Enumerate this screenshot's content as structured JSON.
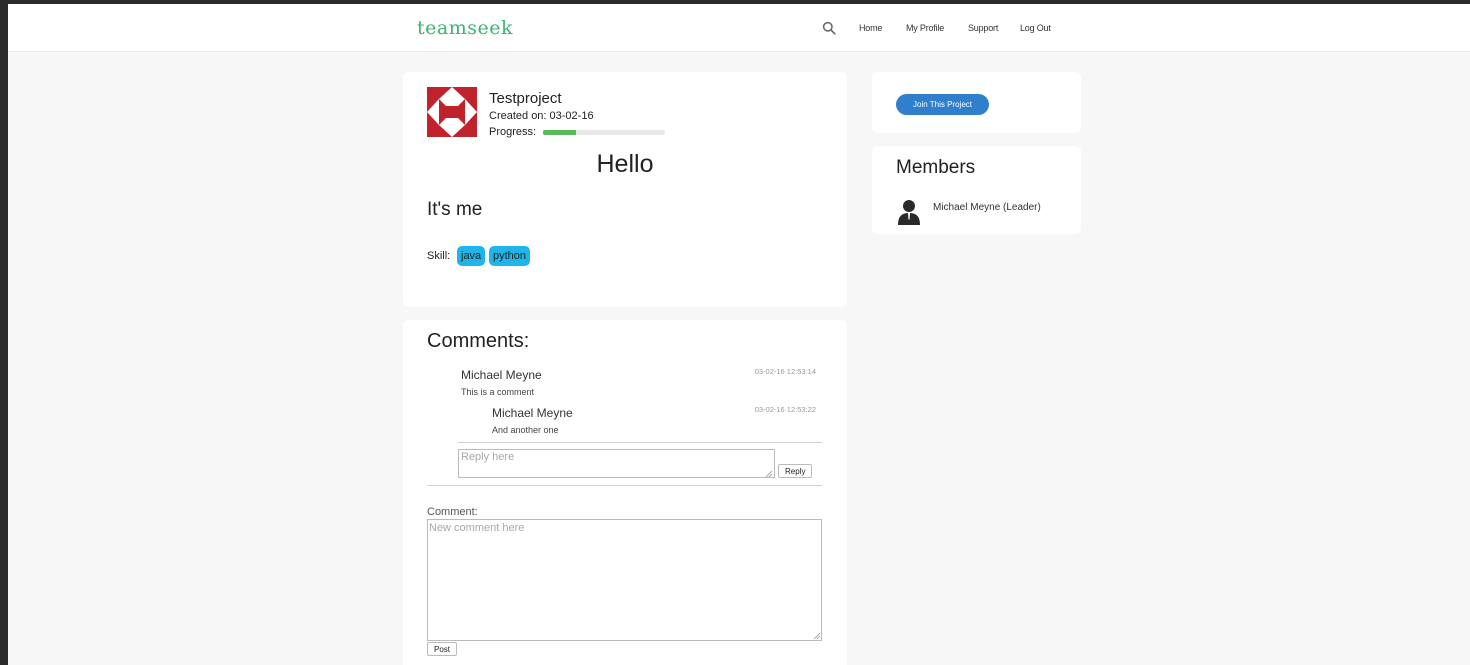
{
  "brand": {
    "logo": "teamseek",
    "accent": "#3cb371"
  },
  "nav": {
    "search_icon": "search-icon",
    "links": [
      "Home",
      "My Profile",
      "Support",
      "Log Out"
    ]
  },
  "project": {
    "title": "Testproject",
    "created": "Created on: 03-02-16",
    "progress_label": "Progress:",
    "progress": 0.27,
    "heading": "Hello",
    "description": "It's me",
    "skill_label": "Skill:",
    "skills": [
      "java",
      "python"
    ],
    "avatar_icon": "identicon-avatar",
    "avatar_color": "#c0232c"
  },
  "comments": {
    "heading": "Comments:",
    "items": [
      {
        "author": "Michael Meyne",
        "time": "03-02-16 12:53:14",
        "text": "This is a comment"
      },
      {
        "author": "Michael Meyne",
        "time": "03-02-16 12:53:22",
        "text": "And another one"
      }
    ],
    "reply_placeholder": "Reply here",
    "reply_button": "Reply",
    "comment_label": "Comment:",
    "new_comment_placeholder": "New comment here",
    "post_button": "Post"
  },
  "sidebar": {
    "join_button": "Join This Project",
    "join_color": "#2f7fcc",
    "members_heading": "Members",
    "members": [
      {
        "name": "Michael Meyne (Leader)",
        "icon": "user-silhouette-icon"
      }
    ]
  }
}
